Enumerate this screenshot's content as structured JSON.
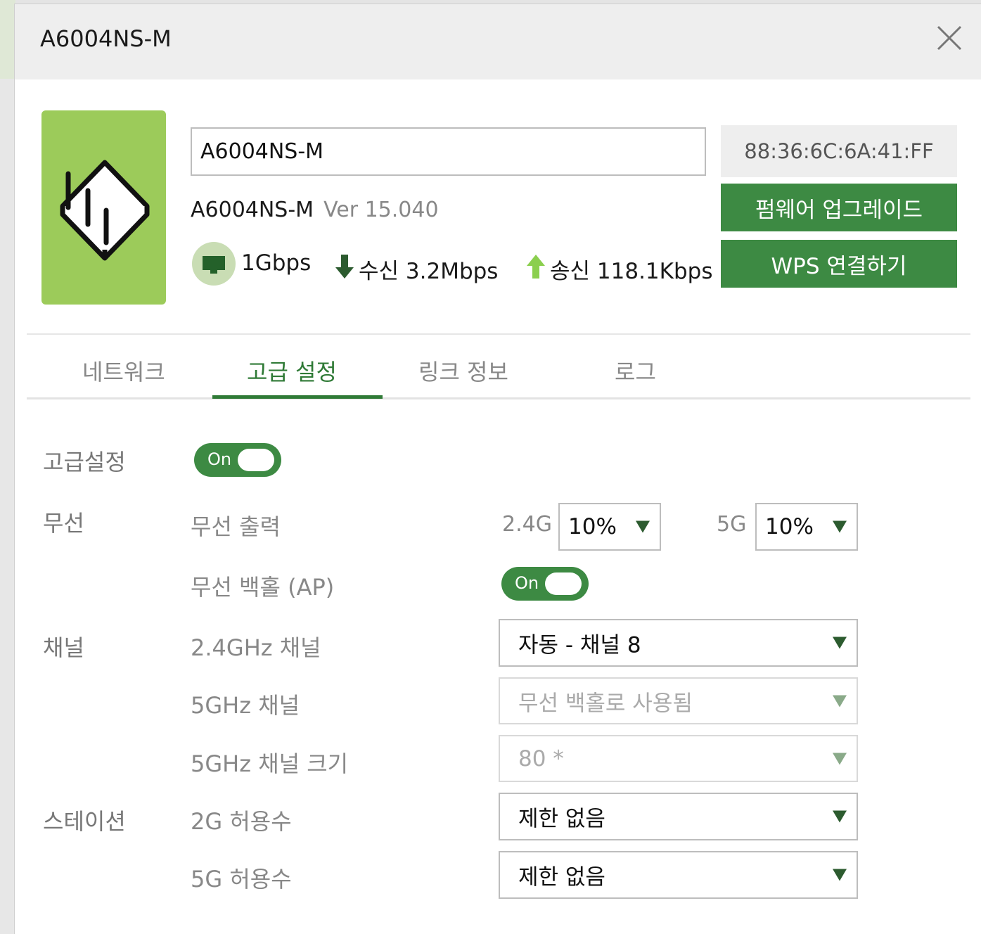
{
  "dialog": {
    "title": "A6004NS-M"
  },
  "device": {
    "name_value": "A6004NS-M",
    "model": "A6004NS-M",
    "version": "Ver 15.040",
    "mac": "88:36:6C:6A:41:FF",
    "link_speed": "1Gbps",
    "download": "수신 3.2Mbps",
    "upload": "송신 118.1Kbps"
  },
  "buttons": {
    "firmware_upgrade": "펌웨어 업그레이드",
    "wps_connect": "WPS 연결하기"
  },
  "tabs": [
    {
      "label": "네트워크",
      "active": false
    },
    {
      "label": "고급 설정",
      "active": true
    },
    {
      "label": "링크 정보",
      "active": false
    },
    {
      "label": "로그",
      "active": false
    }
  ],
  "settings": {
    "advanced": {
      "label": "고급설정",
      "toggle": "On"
    },
    "wireless": {
      "label": "무선",
      "output_label": "무선 출력",
      "band_24": "2.4G",
      "band_24_value": "10%",
      "band_5": "5G",
      "band_5_value": "10%",
      "backhaul_label": "무선 백홀 (AP)",
      "backhaul_toggle": "On"
    },
    "channel": {
      "label": "채널",
      "ch24_label": "2.4GHz 채널",
      "ch24_value": "자동 - 채널 8",
      "ch5_label": "5GHz 채널",
      "ch5_value": "무선 백홀로 사용됨",
      "ch5_width_label": "5GHz 채널 크기",
      "ch5_width_value": "80 *"
    },
    "station": {
      "label": "스테이션",
      "limit_2g_label": "2G 허용수",
      "limit_2g_value": "제한 없음",
      "limit_5g_label": "5G 허용수",
      "limit_5g_value": "제한 없음"
    }
  },
  "colors": {
    "accent": "#3d8a43",
    "device_bg": "#9ccb5a",
    "header_bg": "#eeeeee"
  },
  "icons": [
    "close-icon",
    "router-icon",
    "ethernet-icon",
    "download-arrow-icon",
    "upload-arrow-icon",
    "dropdown-arrow-icon"
  ]
}
